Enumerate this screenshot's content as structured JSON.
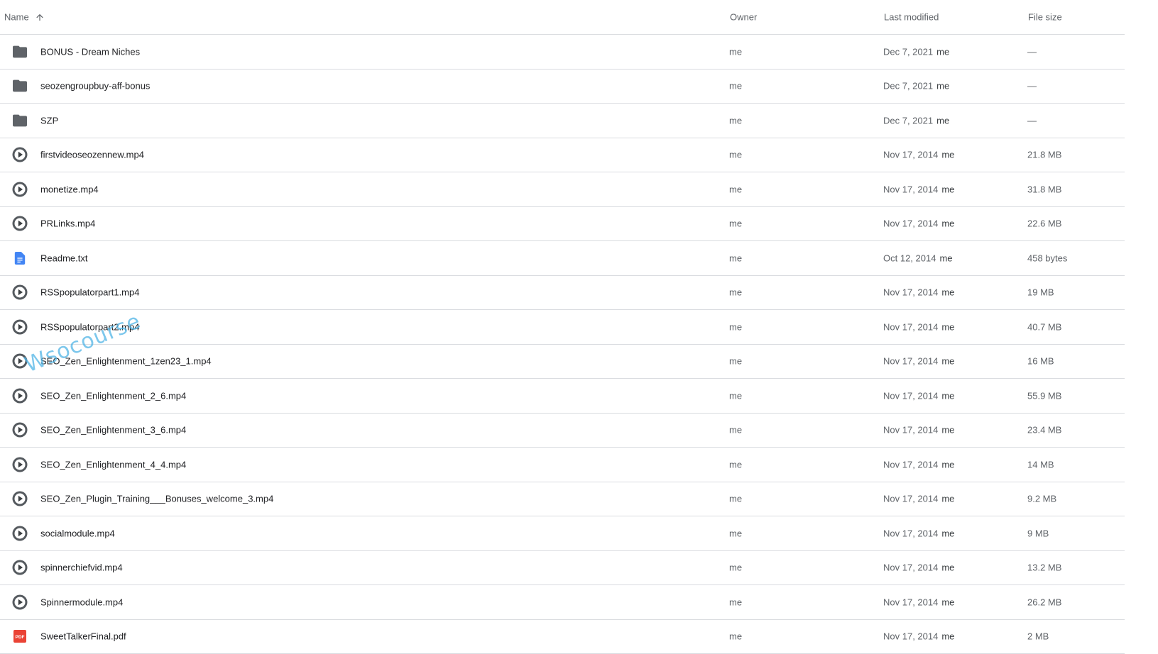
{
  "columns": {
    "name": "Name",
    "owner": "Owner",
    "modified": "Last modified",
    "size": "File size"
  },
  "sort_icon": "arrow-up-icon",
  "colors": {
    "folder": "#5f6368",
    "video": "#5f6368",
    "doc": "#4285f4",
    "pdf": "#ea4335",
    "divider": "#dadce0"
  },
  "files": [
    {
      "icon": "folder-icon",
      "name": "BONUS - Dream Niches",
      "owner": "me",
      "date": "Dec 7, 2021",
      "by": "me",
      "size": "—"
    },
    {
      "icon": "folder-icon",
      "name": "seozengroupbuy-aff-bonus",
      "owner": "me",
      "date": "Dec 7, 2021",
      "by": "me",
      "size": "—"
    },
    {
      "icon": "folder-icon",
      "name": "SZP",
      "owner": "me",
      "date": "Dec 7, 2021",
      "by": "me",
      "size": "—"
    },
    {
      "icon": "video-icon",
      "name": "firstvideoseozennew.mp4",
      "owner": "me",
      "date": "Nov 17, 2014",
      "by": "me",
      "size": "21.8 MB"
    },
    {
      "icon": "video-icon",
      "name": "monetize.mp4",
      "owner": "me",
      "date": "Nov 17, 2014",
      "by": "me",
      "size": "31.8 MB"
    },
    {
      "icon": "video-icon",
      "name": "PRLinks.mp4",
      "owner": "me",
      "date": "Nov 17, 2014",
      "by": "me",
      "size": "22.6 MB"
    },
    {
      "icon": "doc-icon",
      "name": "Readme.txt",
      "owner": "me",
      "date": "Oct 12, 2014",
      "by": "me",
      "size": "458 bytes"
    },
    {
      "icon": "video-icon",
      "name": "RSSpopulatorpart1.mp4",
      "owner": "me",
      "date": "Nov 17, 2014",
      "by": "me",
      "size": "19 MB"
    },
    {
      "icon": "video-icon",
      "name": "RSSpopulatorpart2.mp4",
      "owner": "me",
      "date": "Nov 17, 2014",
      "by": "me",
      "size": "40.7 MB"
    },
    {
      "icon": "video-icon",
      "name": "SEO_Zen_Enlightenment_1zen23_1.mp4",
      "owner": "me",
      "date": "Nov 17, 2014",
      "by": "me",
      "size": "16 MB"
    },
    {
      "icon": "video-icon",
      "name": "SEO_Zen_Enlightenment_2_6.mp4",
      "owner": "me",
      "date": "Nov 17, 2014",
      "by": "me",
      "size": "55.9 MB"
    },
    {
      "icon": "video-icon",
      "name": "SEO_Zen_Enlightenment_3_6.mp4",
      "owner": "me",
      "date": "Nov 17, 2014",
      "by": "me",
      "size": "23.4 MB"
    },
    {
      "icon": "video-icon",
      "name": "SEO_Zen_Enlightenment_4_4.mp4",
      "owner": "me",
      "date": "Nov 17, 2014",
      "by": "me",
      "size": "14 MB"
    },
    {
      "icon": "video-icon",
      "name": "SEO_Zen_Plugin_Training___Bonuses_welcome_3.mp4",
      "owner": "me",
      "date": "Nov 17, 2014",
      "by": "me",
      "size": "9.2 MB"
    },
    {
      "icon": "video-icon",
      "name": "socialmodule.mp4",
      "owner": "me",
      "date": "Nov 17, 2014",
      "by": "me",
      "size": "9 MB"
    },
    {
      "icon": "video-icon",
      "name": "spinnerchiefvid.mp4",
      "owner": "me",
      "date": "Nov 17, 2014",
      "by": "me",
      "size": "13.2 MB"
    },
    {
      "icon": "video-icon",
      "name": "Spinnermodule.mp4",
      "owner": "me",
      "date": "Nov 17, 2014",
      "by": "me",
      "size": "26.2 MB"
    },
    {
      "icon": "pdf-icon",
      "name": "SweetTalkerFinal.pdf",
      "owner": "me",
      "date": "Nov 17, 2014",
      "by": "me",
      "size": "2 MB"
    }
  ],
  "watermark": "Wsocourse"
}
